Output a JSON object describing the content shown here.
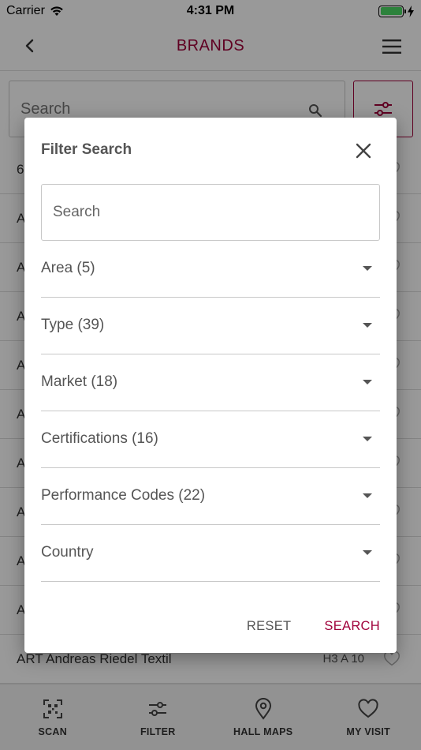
{
  "status_bar": {
    "carrier": "Carrier",
    "time": "4:31 PM"
  },
  "nav": {
    "title": "BRANDS"
  },
  "search": {
    "placeholder": "Search"
  },
  "list": {
    "rows": [
      {
        "prefix": "6",
        "code": ""
      },
      {
        "prefix": "A",
        "code": ""
      },
      {
        "prefix": "A",
        "code": ""
      },
      {
        "prefix": "A",
        "code": ""
      },
      {
        "prefix": "A",
        "code": ""
      },
      {
        "prefix": "A",
        "code": ""
      },
      {
        "prefix": "A",
        "code": ""
      },
      {
        "prefix": "A",
        "code": ""
      },
      {
        "prefix": "A",
        "code": ""
      },
      {
        "prefix": "A",
        "code": ""
      },
      {
        "prefix": "ART Andreas Riedel Textil",
        "code": "H3 A 10"
      }
    ]
  },
  "tabs": [
    {
      "label": "SCAN",
      "icon": "qr-scan-icon"
    },
    {
      "label": "FILTER",
      "icon": "sliders-icon"
    },
    {
      "label": "HALL MAPS",
      "icon": "map-pin-icon"
    },
    {
      "label": "MY VISIT",
      "icon": "heart-icon"
    }
  ],
  "modal": {
    "title": "Filter Search",
    "search_placeholder": "Search",
    "dropdowns": [
      {
        "label": "Area (5)"
      },
      {
        "label": "Type (39)"
      },
      {
        "label": "Market (18)"
      },
      {
        "label": "Certifications (16)"
      },
      {
        "label": "Performance Codes (22)"
      },
      {
        "label": "Country"
      }
    ],
    "reset_label": "RESET",
    "search_label": "SEARCH"
  },
  "colors": {
    "accent": "#a0003a",
    "battery": "#4cd964"
  }
}
